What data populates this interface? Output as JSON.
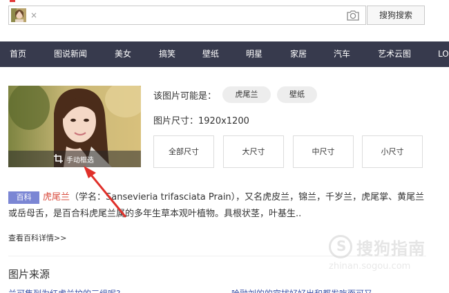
{
  "search": {
    "thumb_alt": "",
    "close_glyph": "×",
    "button_label": "搜狗搜索"
  },
  "nav": {
    "items": [
      "首页",
      "图说新闻",
      "美女",
      "搞笑",
      "壁纸",
      "明星",
      "家居",
      "汽车",
      "艺术云图",
      "LO"
    ]
  },
  "image": {
    "crop_label": "手动框选"
  },
  "info": {
    "maybe_label": "该图片可能是：",
    "tags": [
      "虎尾兰",
      "壁纸"
    ],
    "size_label": "图片尺寸：1920x1200",
    "size_buttons": [
      "全部尺寸",
      "大尺寸",
      "中尺寸",
      "小尺寸"
    ]
  },
  "baike": {
    "badge": "百科",
    "keyword": "虎尾兰",
    "text": "（学名：Sansevieria trifasciata Prain），又名虎皮兰，锦兰，千岁兰，虎尾掌、黄尾兰或岳母舌，是百合科虎尾兰属的多年生草本观叶植物。具根状茎，叶基生..",
    "more_link": "查看百科详情>>"
  },
  "source": {
    "title": "图片来源",
    "cut_left": "兰可集列为红虎兰护的三组呢?",
    "cut_right": "哈融刘的的宫扰好好出和都发吃而可又"
  },
  "watermark": {
    "logo_char": "S",
    "text": "搜狗指南",
    "url": "zhinan.sogou.com"
  },
  "colors": {
    "nav_bg": "#373a4d",
    "badge_bg": "#7b86d4",
    "keyword": "#d94c3e",
    "arrow": "#e0302a"
  }
}
